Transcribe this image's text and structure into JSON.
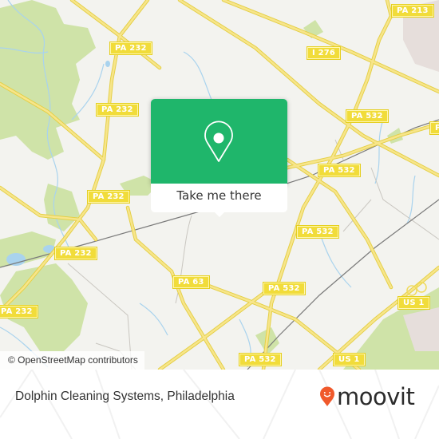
{
  "map": {
    "attribution": "© OpenStreetMap contributors",
    "road_shields": [
      {
        "label": "PA 213"
      },
      {
        "label": "PA 232"
      },
      {
        "label": "I 276"
      },
      {
        "label": "PA 232"
      },
      {
        "label": "PA 532"
      },
      {
        "label": "PA 532"
      },
      {
        "label": "PA 232"
      },
      {
        "label": "PA 532"
      },
      {
        "label": "PA 232"
      },
      {
        "label": "PA 63"
      },
      {
        "label": "PA 532"
      },
      {
        "label": "US 1"
      },
      {
        "label": "PA 232"
      },
      {
        "label": "PA 532"
      },
      {
        "label": "US 1"
      },
      {
        "label": "PA"
      }
    ],
    "colors": {
      "background": "#f3f3ef",
      "road": "#f5e17a",
      "park": "#cfe3a8",
      "water": "#a9d3ee",
      "popup_green": "#1fb66b"
    }
  },
  "popup": {
    "icon": "location-pin-icon",
    "button_label": "Take me there"
  },
  "footer": {
    "place_title": "Dolphin Cleaning Systems, Philadelphia",
    "brand": "moovit",
    "brand_icon": "moovit-pin-smile-icon",
    "brand_color": "#f0592b"
  }
}
